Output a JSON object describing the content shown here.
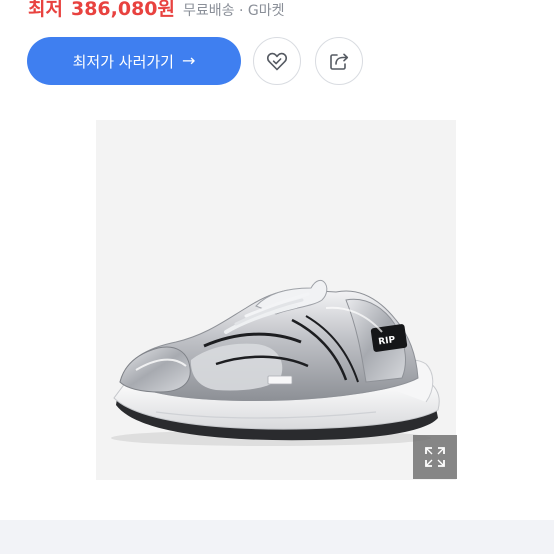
{
  "price": {
    "label": "최저",
    "value": "386,080원",
    "meta": "무료배송 · G마켓",
    "accent_color": "#e8423f"
  },
  "actions": {
    "buy_label": "최저가 사러가기",
    "buy_arrow": "→",
    "buy_color": "#3f7ff0",
    "wish_icon": "heart-check-icon",
    "share_icon": "share-icon"
  },
  "product": {
    "image": "silver-chunky-sneaker",
    "tongue_text": "RIP",
    "expand_icon": "expand-icon"
  }
}
